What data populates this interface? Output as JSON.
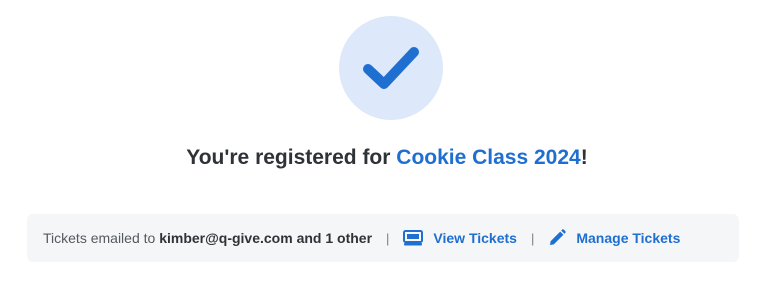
{
  "confirmation": {
    "icon": "checkmark-icon",
    "headline_prefix": "You're registered for ",
    "event_name": "Cookie Class 2024",
    "headline_suffix": "!"
  },
  "info_bar": {
    "tickets_prefix": "Tickets emailed to ",
    "email": "kimber@q-give.com",
    "and_others": "and 1 other",
    "separator": "|",
    "view_tickets_label": "View Tickets",
    "view_tickets_icon": "ticket-icon",
    "manage_tickets_label": "Manage Tickets",
    "manage_tickets_icon": "pencil-icon"
  },
  "colors": {
    "accent": "#1f6fd1",
    "check_circle_bg": "#dde8fa",
    "info_bar_bg": "#f5f6f8",
    "text_dark": "#2f3337"
  }
}
